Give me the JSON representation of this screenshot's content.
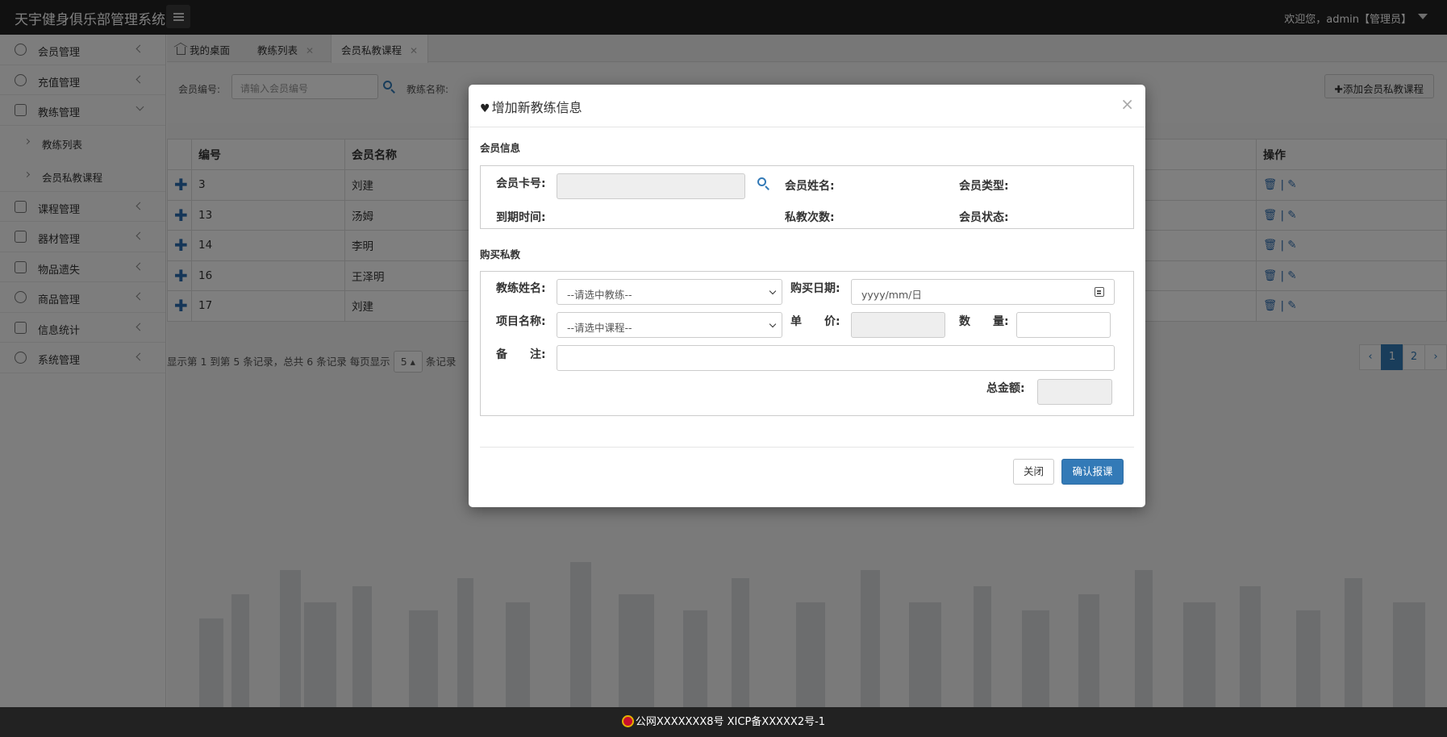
{
  "app": {
    "title": "天宇健身俱乐部管理系统",
    "welcome": "欢迎您，admin【管理员】"
  },
  "sidebar": {
    "items": [
      {
        "label": "会员管理",
        "icon": "user-icon"
      },
      {
        "label": "充值管理",
        "icon": "recharge-icon"
      },
      {
        "label": "教练管理",
        "icon": "coach-icon",
        "expanded": true
      },
      {
        "label": "课程管理",
        "icon": "course-icon"
      },
      {
        "label": "器材管理",
        "icon": "equipment-icon"
      },
      {
        "label": "物品遗失",
        "icon": "lost-item-icon"
      },
      {
        "label": "商品管理",
        "icon": "goods-icon"
      },
      {
        "label": "信息统计",
        "icon": "stats-icon"
      },
      {
        "label": "系统管理",
        "icon": "system-icon"
      }
    ],
    "subitems": [
      "教练列表",
      "会员私教课程"
    ]
  },
  "tabs": [
    {
      "label": "我的桌面"
    },
    {
      "label": "教练列表"
    },
    {
      "label": "会员私教课程"
    }
  ],
  "search": {
    "member_no_label": "会员编号:",
    "member_no_placeholder": "请输入会员编号",
    "coach_name_label": "教练名称:",
    "add_button": "✚添加会员私教课程"
  },
  "table": {
    "headers": [
      "编号",
      "会员名称",
      "操作"
    ],
    "rows": [
      {
        "id": "3",
        "name": "刘建"
      },
      {
        "id": "13",
        "name": "汤姆"
      },
      {
        "id": "14",
        "name": "李明"
      },
      {
        "id": "16",
        "name": "王泽明"
      },
      {
        "id": "17",
        "name": "刘建"
      }
    ],
    "op_separator": "|"
  },
  "pager": {
    "text_before": "显示第 1 到第 5 条记录，总共 6 条记录 每页显示",
    "page_size": "5",
    "text_after": "条记录",
    "pages": [
      "‹",
      "1",
      "2",
      "›"
    ],
    "current_page": "1"
  },
  "modal": {
    "title": "增加新教练信息",
    "close": "×",
    "member_section": "会员信息",
    "card_no_label": "会员卡号:",
    "member_name_label": "会员姓名:",
    "member_type_label": "会员类型:",
    "expire_label": "到期时间:",
    "sessions_label": "私教次数:",
    "status_label": "会员状态:",
    "purchase_section": "购买私教",
    "coach_label": "教练姓名:",
    "coach_placeholder": "--请选中教练--",
    "buy_date_label": "购买日期:",
    "buy_date_placeholder": "yyyy/mm/日",
    "course_label": "项目名称:",
    "course_placeholder": "--请选中课程--",
    "price_label": "单　　价:",
    "qty_label": "数　　量:",
    "remark_label": "备　　注:",
    "total_label": "总金额:",
    "cancel_button": "关闭",
    "confirm_button": "确认报课"
  },
  "footer": {
    "text": "公网XXXXXXX8号 XICP备XXXXX2号-1"
  },
  "colors": {
    "accent": "#337ab7",
    "topbar": "#222222"
  }
}
